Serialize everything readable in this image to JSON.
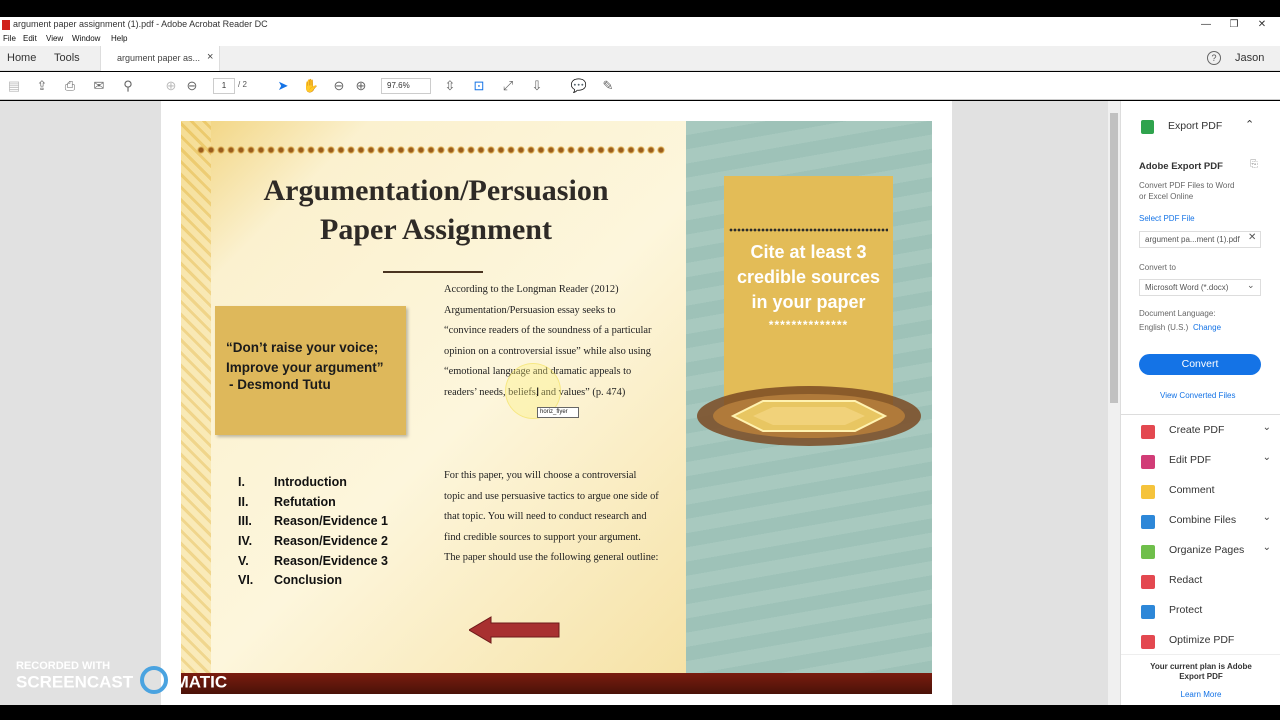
{
  "window": {
    "title": "argument paper assignment (1).pdf - Adobe Acrobat Reader DC",
    "controls": [
      "—",
      "❐",
      "✕"
    ]
  },
  "menu": [
    "File",
    "Edit",
    "View",
    "Window",
    "Help"
  ],
  "tabs": {
    "home": "Home",
    "tools": "Tools",
    "document": "argument paper as...",
    "close": "×"
  },
  "account": {
    "help_icon": "?",
    "user": "Jason"
  },
  "toolbar": {
    "page_current": "1",
    "page_total": "/ 2",
    "zoom": "97.6%"
  },
  "pdf": {
    "title_line1": "Argumentation/Persuasion",
    "title_line2": "Paper Assignment",
    "quote_line1": "“Don’t raise your voice;",
    "quote_line2": "Improve your argument”",
    "quote_author": "-   Desmond Tutu",
    "outline": [
      {
        "num": "I.",
        "label": "Introduction"
      },
      {
        "num": "II.",
        "label": "Refutation"
      },
      {
        "num": "III.",
        "label": "Reason/Evidence 1"
      },
      {
        "num": "IV.",
        "label": "Reason/Evidence 2"
      },
      {
        "num": "V.",
        "label": "Reason/Evidence 3"
      },
      {
        "num": "VI.",
        "label": "Conclusion"
      }
    ],
    "para1": "According to the Longman Reader (2012) Argumentation/Persuasion essay seeks to “convince readers of the soundness of a particular opinion on a controversial issue” while also using “emotional language and dramatic appeals to readers’ needs, beliefs, and values” (p. 474)",
    "para2": "For this paper, you will choose a controversial topic and use persuasive tactics to argue one side of that topic. You will need to conduct research and find credible sources to support your argument.  The paper should use the following general outline:",
    "banner_line1": "Cite at least 3",
    "banner_line2": "credible sources",
    "banner_line3": "in your paper",
    "banner_stars": "**************",
    "tooltip": "horiz_flyer"
  },
  "right_panel": {
    "export_title": "Export PDF",
    "adobe_export": "Adobe Export PDF",
    "convert_desc_1": "Convert PDF Files to Word",
    "convert_desc_2": "or Excel Online",
    "select_label": "Select PDF File",
    "file_value": "argument pa...ment (1).pdf",
    "convert_to_label": "Convert to",
    "convert_to_value": "Microsoft Word (*.docx)",
    "doc_lang_label": "Document Language:",
    "doc_lang_value": "English (U.S.)",
    "change_link": "Change",
    "convert_button": "Convert",
    "view_converted": "View Converted Files",
    "tools": [
      {
        "label": "Create PDF",
        "icon": "create-pdf-icon",
        "color": "#e34850",
        "chevron": "⌄"
      },
      {
        "label": "Edit PDF",
        "icon": "edit-pdf-icon",
        "color": "#d13c77",
        "chevron": "⌄"
      },
      {
        "label": "Comment",
        "icon": "comment-icon",
        "color": "#f5c33b",
        "chevron": ""
      },
      {
        "label": "Combine Files",
        "icon": "combine-files-icon",
        "color": "#2d87d8",
        "chevron": "⌄"
      },
      {
        "label": "Organize Pages",
        "icon": "organize-pages-icon",
        "color": "#6fbf4b",
        "chevron": "⌄"
      },
      {
        "label": "Redact",
        "icon": "redact-icon",
        "color": "#e34850",
        "chevron": ""
      },
      {
        "label": "Protect",
        "icon": "protect-icon",
        "color": "#2d87d8",
        "chevron": ""
      },
      {
        "label": "Optimize PDF",
        "icon": "optimize-pdf-icon",
        "color": "#e34850",
        "chevron": ""
      }
    ],
    "plan_line1": "Your current plan is Adobe",
    "plan_line2": "Export PDF",
    "learn_more": "Learn More"
  },
  "watermark": {
    "line1": "RECORDED WITH",
    "line2a": "SCREENCAST",
    "line2b": "MATIC"
  }
}
